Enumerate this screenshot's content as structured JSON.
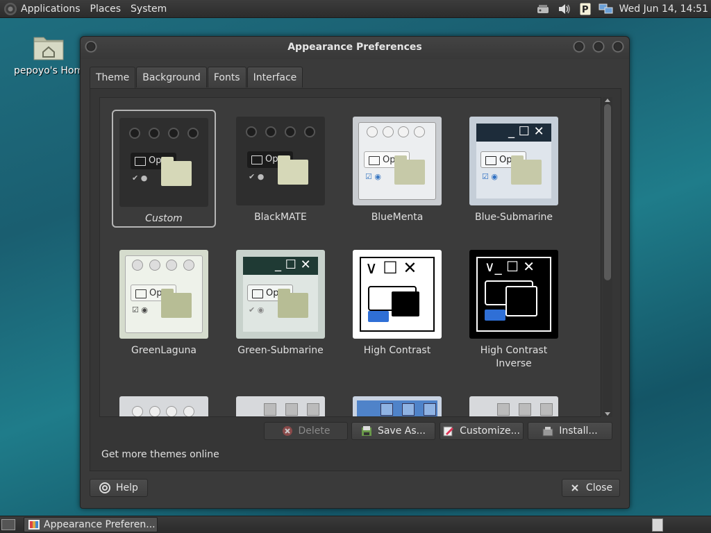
{
  "top_panel": {
    "menus": [
      "Applications",
      "Places",
      "System"
    ],
    "clock": "Wed Jun 14, 14:51",
    "tray_icons": [
      "network-wired-icon",
      "volume-icon",
      "parcellite-icon",
      "network-icon"
    ]
  },
  "desktop": {
    "home_label": "pepoyo's Home"
  },
  "window": {
    "title": "Appearance Preferences",
    "tabs": [
      {
        "label": "Theme",
        "active": true
      },
      {
        "label": "Background",
        "active": false
      },
      {
        "label": "Fonts",
        "active": false
      },
      {
        "label": "Interface",
        "active": false
      }
    ],
    "themes": [
      {
        "name": "Custom",
        "selected": true
      },
      {
        "name": "BlackMATE",
        "selected": false
      },
      {
        "name": "BlueMenta",
        "selected": false
      },
      {
        "name": "Blue-Submarine",
        "selected": false
      },
      {
        "name": "GreenLaguna",
        "selected": false
      },
      {
        "name": "Green-Submarine",
        "selected": false
      },
      {
        "name": "High Contrast",
        "selected": false
      },
      {
        "name": "High Contrast Inverse",
        "selected": false
      }
    ],
    "thumb_open_label": "Open",
    "buttons": {
      "delete": "Delete",
      "save_as": "Save As...",
      "customize": "Customize...",
      "install": "Install...",
      "help": "Help",
      "close": "Close"
    },
    "more_themes_link": "Get more themes online"
  },
  "bottom_panel": {
    "task_label": "Appearance Preferen..."
  }
}
